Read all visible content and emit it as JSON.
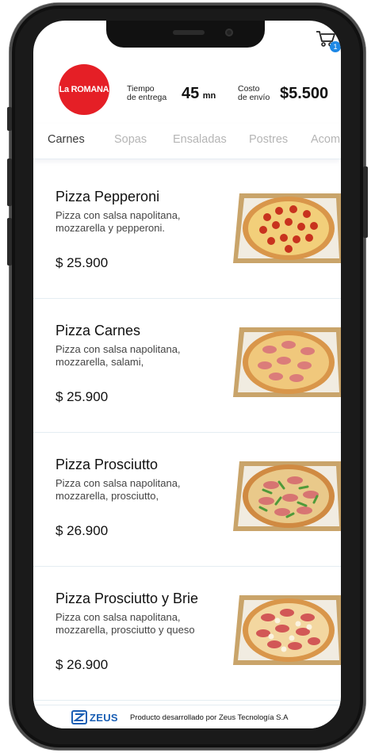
{
  "cart": {
    "count": "1"
  },
  "restaurant": {
    "logo_text": "La ROMANA"
  },
  "delivery": {
    "label_line1": "Tiempo",
    "label_line2": "de entrega",
    "value": "45",
    "unit": "mn"
  },
  "shipping": {
    "label_line1": "Costo",
    "label_line2": "de envío",
    "value": "$5.500"
  },
  "tabs": [
    {
      "label": "Carnes",
      "active": true
    },
    {
      "label": "Sopas"
    },
    {
      "label": "Ensaladas"
    },
    {
      "label": "Postres"
    },
    {
      "label": "Acomp."
    }
  ],
  "products": [
    {
      "name": "Pizza Pepperoni",
      "description": "Pizza con salsa napolitana, mozzarella y pepperoni.",
      "price": "$ 25.900"
    },
    {
      "name": "Pizza Carnes",
      "description": "Pizza con salsa napolitana, mozzarella, salami,",
      "price": "$ 25.900"
    },
    {
      "name": "Pizza Prosciutto",
      "description": "Pizza con salsa napolitana, mozzarella, prosciutto,",
      "price": "$ 26.900"
    },
    {
      "name": "Pizza Prosciutto y Brie",
      "description": "Pizza con salsa napolitana, mozzarella, prosciutto y queso",
      "price": "$ 26.900"
    }
  ],
  "footer": {
    "brand": "ZEUS",
    "text": "Producto desarrollado por Zeus Tecnología S.A"
  },
  "colors": {
    "brand_red": "#e51f26",
    "badge_blue": "#1e88e5",
    "zeus_blue": "#1a5fb4"
  }
}
